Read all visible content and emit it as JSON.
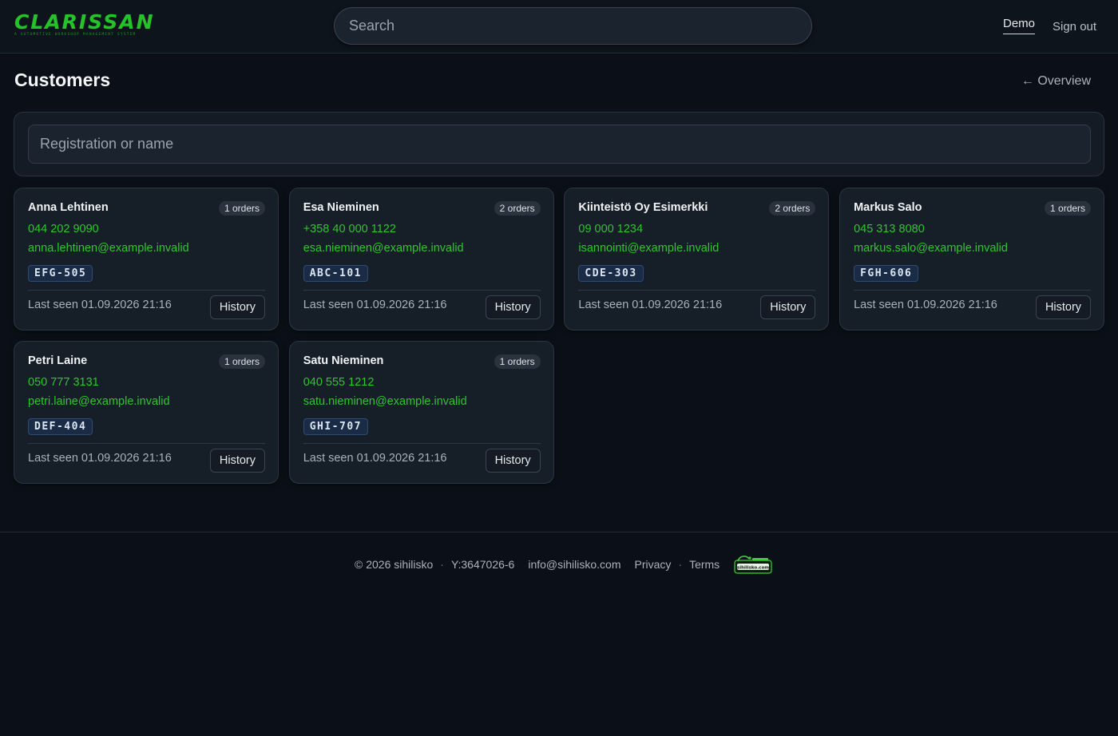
{
  "header": {
    "logo_text": "CLARISSAN",
    "logo_tagline": "A AUTOMOTIVE WORKSHOP MANAGEMENT SYSTEM",
    "search_placeholder": "Search",
    "nav_demo": "Demo",
    "nav_signout": "Sign out"
  },
  "page": {
    "title": "Customers",
    "back_link": "← Overview",
    "filter_placeholder": "Registration or name"
  },
  "customers": [
    {
      "name": "Anna Lehtinen",
      "orders": "1 orders",
      "phone": "044 202 9090",
      "email": "anna.lehtinen@example.invalid",
      "plate": "EFG-505",
      "last_seen": "Last seen 01.09.2026 21:16",
      "history_label": "History"
    },
    {
      "name": "Esa Nieminen",
      "orders": "2 orders",
      "phone": "+358 40 000 1122",
      "email": "esa.nieminen@example.invalid",
      "plate": "ABC-101",
      "last_seen": "Last seen 01.09.2026 21:16",
      "history_label": "History"
    },
    {
      "name": "Kiinteistö Oy Esimerkki",
      "orders": "2 orders",
      "phone": "09 000 1234",
      "email": "isannointi@example.invalid",
      "plate": "CDE-303",
      "last_seen": "Last seen 01.09.2026 21:16",
      "history_label": "History"
    },
    {
      "name": "Markus Salo",
      "orders": "1 orders",
      "phone": "045 313 8080",
      "email": "markus.salo@example.invalid",
      "plate": "FGH-606",
      "last_seen": "Last seen 01.09.2026 21:16",
      "history_label": "History"
    },
    {
      "name": "Petri Laine",
      "orders": "1 orders",
      "phone": "050 777 3131",
      "email": "petri.laine@example.invalid",
      "plate": "DEF-404",
      "last_seen": "Last seen 01.09.2026 21:16",
      "history_label": "History"
    },
    {
      "name": "Satu Nieminen",
      "orders": "1 orders",
      "phone": "040 555 1212",
      "email": "satu.nieminen@example.invalid",
      "plate": "GHI-707",
      "last_seen": "Last seen 01.09.2026 21:16",
      "history_label": "History"
    }
  ],
  "footer": {
    "copyright": "© 2026 sihilisko",
    "business_id": "Y:3647026-6",
    "email": "info@sihilisko.com",
    "privacy": "Privacy",
    "terms": "Terms",
    "logo_text": "sihilisko.com"
  },
  "colors": {
    "background": "#0b1018",
    "accent_green": "#2fc52f",
    "card": "#161e28"
  }
}
